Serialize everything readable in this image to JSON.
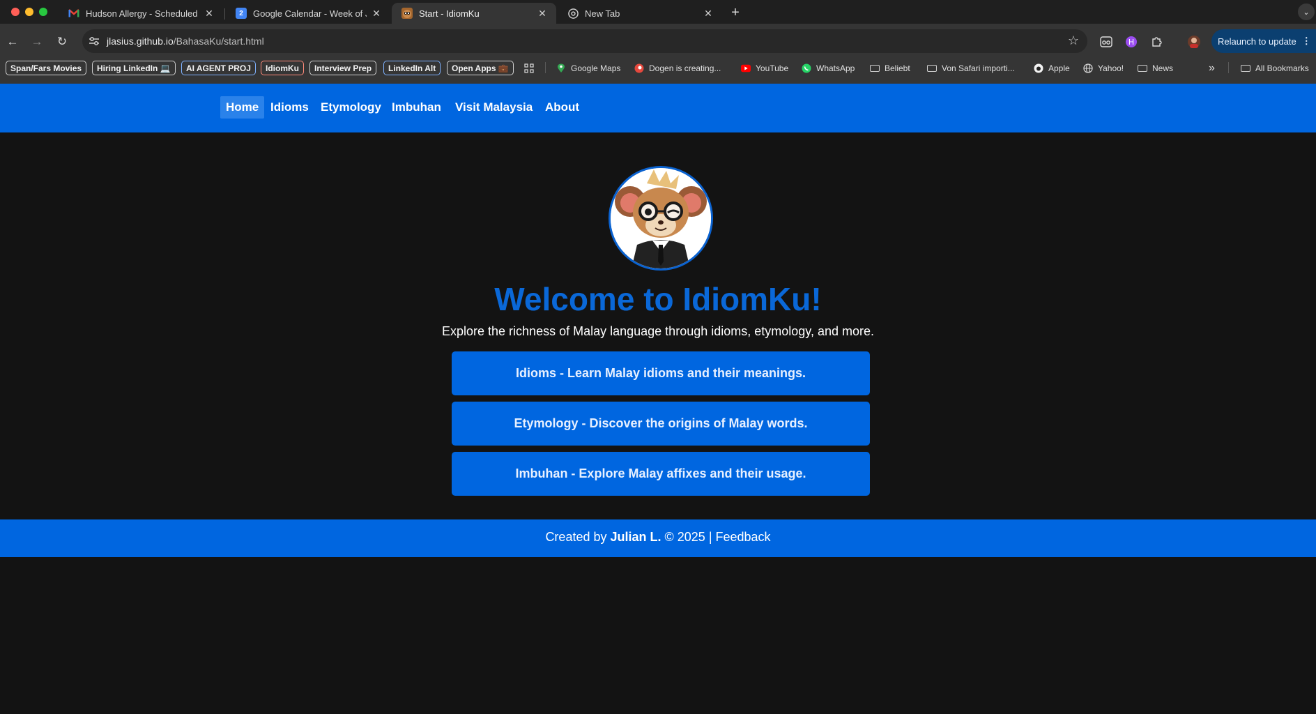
{
  "browser": {
    "tabs": [
      {
        "title": "Hudson Allergy - Scheduled I",
        "favicon": "gmail-icon"
      },
      {
        "title": "Google Calendar - Week of Ju",
        "favicon": "calendar-icon",
        "favicon_text": "2"
      },
      {
        "title": "Start - IdiomKu",
        "favicon": "idiomku-icon",
        "active": true
      },
      {
        "title": "New Tab",
        "favicon": "chrome-icon"
      }
    ],
    "url_host": "jlasius.github.io",
    "url_path": "/BahasaKu/start.html",
    "relaunch_label": "Relaunch to update"
  },
  "bookmarks": {
    "pills": [
      {
        "label": "Span/Fars Movies",
        "color": "#d0d0d0"
      },
      {
        "label": "Hiring LinkedIn 💻",
        "color": "#d0d0d0"
      },
      {
        "label": "AI AGENT PROJ",
        "color": "#7fb2ff"
      },
      {
        "label": "IdiomKu",
        "color": "#ff8a7a"
      },
      {
        "label": "Interview Prep",
        "color": "#d0d0d0"
      },
      {
        "label": "LinkedIn Alt",
        "color": "#7fb2ff"
      },
      {
        "label": "Open Apps 💼",
        "color": "#d0d0d0"
      }
    ],
    "items": [
      {
        "label": "Google Maps",
        "icon": "maps-icon"
      },
      {
        "label": "Dogen is creating...",
        "icon": "patreon-icon"
      },
      {
        "label": "YouTube",
        "icon": "youtube-icon"
      },
      {
        "label": "WhatsApp",
        "icon": "whatsapp-icon"
      },
      {
        "label": "Beliebt",
        "icon": "folder-icon"
      },
      {
        "label": "Von Safari importi...",
        "icon": "folder-icon"
      },
      {
        "label": "Apple",
        "icon": "apple-icon"
      },
      {
        "label": "Yahoo!",
        "icon": "globe-icon"
      },
      {
        "label": "News",
        "icon": "folder-icon"
      }
    ],
    "all_bookmarks": "All Bookmarks"
  },
  "site": {
    "nav": [
      {
        "label": "Home",
        "active": true
      },
      {
        "label": "Idioms"
      },
      {
        "label": "Etymology"
      },
      {
        "label": "Imbuhan"
      },
      {
        "label": "Visit Malaysia"
      },
      {
        "label": "About"
      }
    ],
    "welcome": "Welcome to IdiomKu!",
    "tagline": "Explore the richness of Malay language through idioms, etymology, and more.",
    "cards": [
      {
        "label": "Idioms - Learn Malay idioms and their meanings."
      },
      {
        "label": "Etymology - Discover the origins of Malay words."
      },
      {
        "label": "Imbuhan - Explore Malay affixes and their usage."
      }
    ],
    "footer": {
      "prefix": "Created by",
      "author": "Julian L.",
      "copyright": "© 2025 |",
      "feedback": "Feedback"
    }
  },
  "colors": {
    "brand_blue": "#0066e0",
    "heading_blue": "#0a68d8",
    "page_bg": "#131313"
  }
}
